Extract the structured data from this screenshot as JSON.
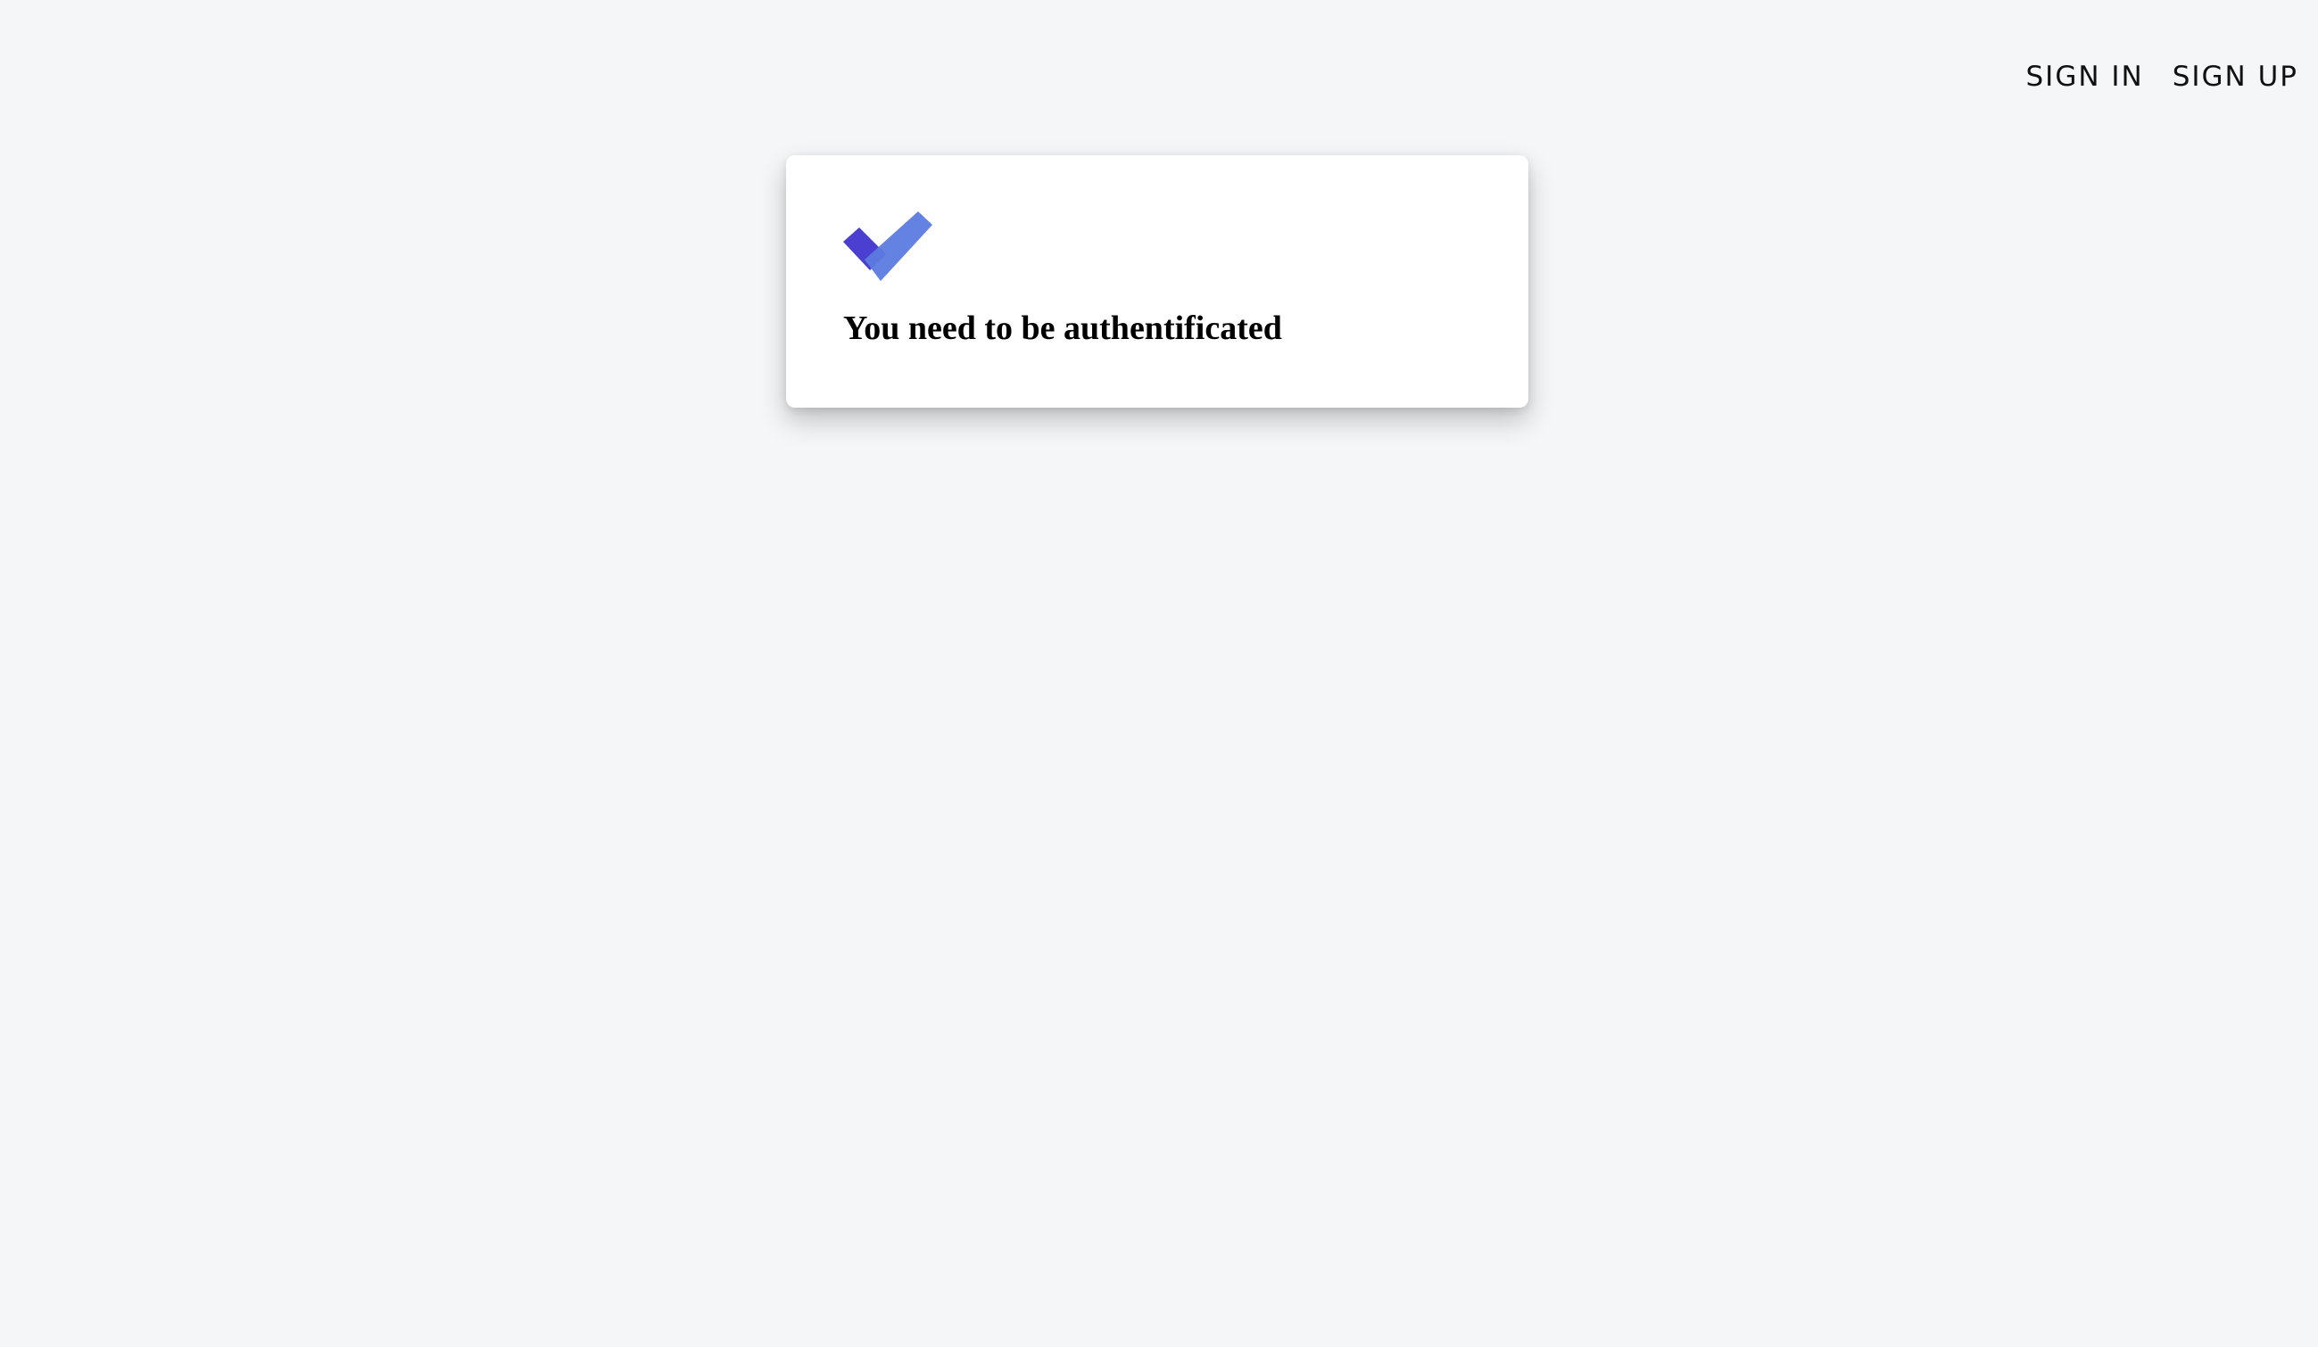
{
  "nav": {
    "sign_in_label": "SIGN IN",
    "sign_up_label": "SIGN UP"
  },
  "card": {
    "logo_icon": "double-check-icon",
    "message": "You need to be authentificated"
  },
  "colors": {
    "background": "#f5f6f8",
    "logo_dark": "#4a3fd0",
    "logo_light": "#5b7be0"
  }
}
